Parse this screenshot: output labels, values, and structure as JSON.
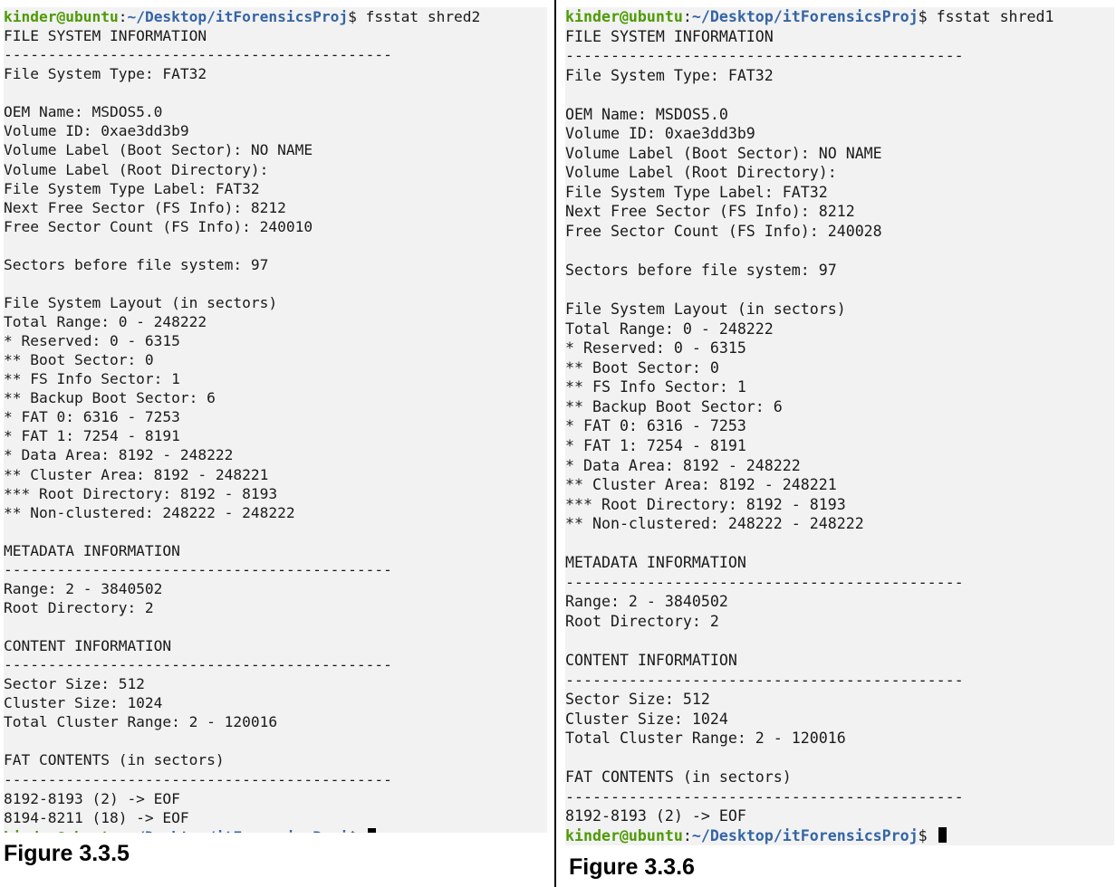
{
  "left_terminal": {
    "prompt_user": "kinder@ubuntu",
    "prompt_sep": ":",
    "prompt_path": "~/Desktop/itForensicsProj",
    "prompt_dollar": "$",
    "command": " fsstat shred2",
    "lines": [
      "FILE SYSTEM INFORMATION",
      "--------------------------------------------",
      "File System Type: FAT32",
      "",
      "OEM Name: MSDOS5.0",
      "Volume ID: 0xae3dd3b9",
      "Volume Label (Boot Sector): NO NAME",
      "Volume Label (Root Directory):",
      "File System Type Label: FAT32",
      "Next Free Sector (FS Info): 8212",
      "Free Sector Count (FS Info): 240010",
      "",
      "Sectors before file system: 97",
      "",
      "File System Layout (in sectors)",
      "Total Range: 0 - 248222",
      "* Reserved: 0 - 6315",
      "** Boot Sector: 0",
      "** FS Info Sector: 1",
      "** Backup Boot Sector: 6",
      "* FAT 0: 6316 - 7253",
      "* FAT 1: 7254 - 8191",
      "* Data Area: 8192 - 248222",
      "** Cluster Area: 8192 - 248221",
      "*** Root Directory: 8192 - 8193",
      "** Non-clustered: 248222 - 248222",
      "",
      "METADATA INFORMATION",
      "--------------------------------------------",
      "Range: 2 - 3840502",
      "Root Directory: 2",
      "",
      "CONTENT INFORMATION",
      "--------------------------------------------",
      "Sector Size: 512",
      "Cluster Size: 1024",
      "Total Cluster Range: 2 - 120016",
      "",
      "FAT CONTENTS (in sectors)",
      "--------------------------------------------",
      "8192-8193 (2) -> EOF",
      "8194-8211 (18) -> EOF"
    ]
  },
  "right_terminal": {
    "prompt_user": "kinder@ubuntu",
    "prompt_sep": ":",
    "prompt_path": "~/Desktop/itForensicsProj",
    "prompt_dollar": "$",
    "command": " fsstat shred1",
    "lines": [
      "FILE SYSTEM INFORMATION",
      "--------------------------------------------",
      "File System Type: FAT32",
      "",
      "OEM Name: MSDOS5.0",
      "Volume ID: 0xae3dd3b9",
      "Volume Label (Boot Sector): NO NAME",
      "Volume Label (Root Directory):",
      "File System Type Label: FAT32",
      "Next Free Sector (FS Info): 8212",
      "Free Sector Count (FS Info): 240028",
      "",
      "Sectors before file system: 97",
      "",
      "File System Layout (in sectors)",
      "Total Range: 0 - 248222",
      "* Reserved: 0 - 6315",
      "** Boot Sector: 0",
      "** FS Info Sector: 1",
      "** Backup Boot Sector: 6",
      "* FAT 0: 6316 - 7253",
      "* FAT 1: 7254 - 8191",
      "* Data Area: 8192 - 248222",
      "** Cluster Area: 8192 - 248221",
      "*** Root Directory: 8192 - 8193",
      "** Non-clustered: 248222 - 248222",
      "",
      "METADATA INFORMATION",
      "--------------------------------------------",
      "Range: 2 - 3840502",
      "Root Directory: 2",
      "",
      "CONTENT INFORMATION",
      "--------------------------------------------",
      "Sector Size: 512",
      "Cluster Size: 1024",
      "Total Cluster Range: 2 - 120016",
      "",
      "FAT CONTENTS (in sectors)",
      "--------------------------------------------",
      "8192-8193 (2) -> EOF"
    ]
  },
  "captions": {
    "left": "Figure 3.3.5",
    "right": "Figure 3.3.6"
  },
  "colors": {
    "terminal_bg": "#f2f2f2",
    "prompt_user": "#4e9a06",
    "prompt_path": "#3465a4",
    "text": "#1a1a1a",
    "divider": "#000000"
  }
}
